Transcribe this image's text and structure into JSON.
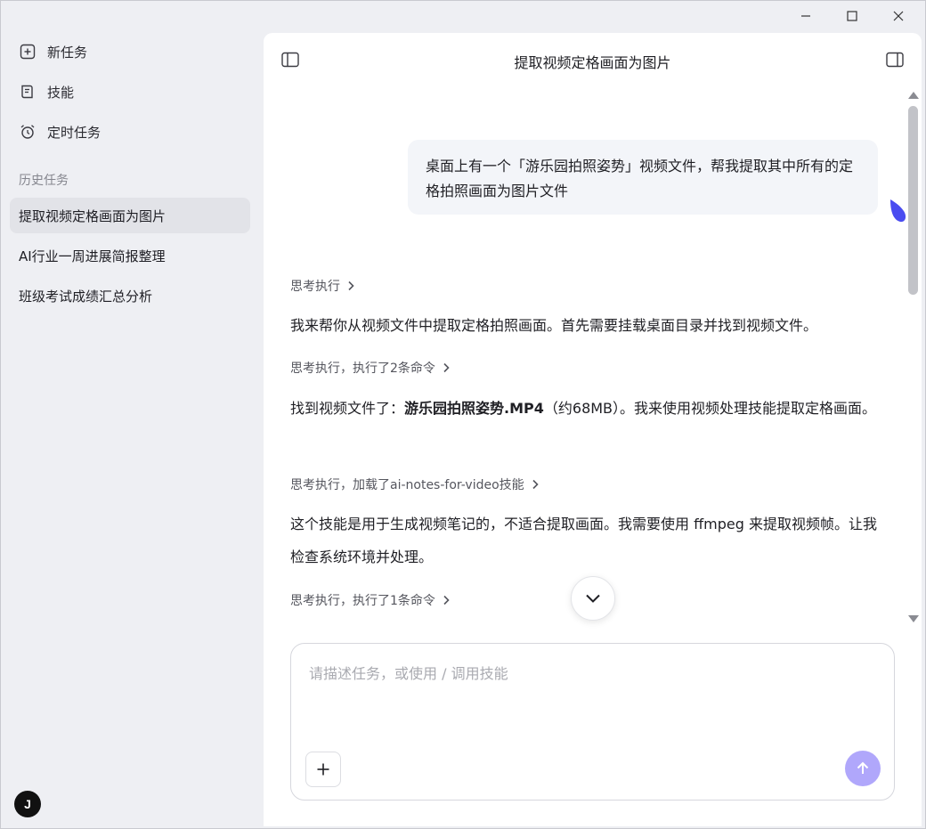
{
  "window": {
    "controls": [
      "minimize-icon",
      "maximize-icon",
      "close-icon"
    ]
  },
  "sidebar": {
    "nav": [
      {
        "label": "新任务",
        "icon": "new-task-icon"
      },
      {
        "label": "技能",
        "icon": "skills-icon"
      },
      {
        "label": "定时任务",
        "icon": "alarm-clock-icon"
      }
    ],
    "history_label": "历史任务",
    "history": [
      {
        "label": "提取视频定格画面为图片",
        "active": true
      },
      {
        "label": "AI行业一周进展简报整理",
        "active": false
      },
      {
        "label": "班级考试成绩汇总分析",
        "active": false
      }
    ],
    "avatar_initial": "J"
  },
  "main": {
    "title": "提取视频定格画面为图片",
    "user_message": "桌面上有一个「游乐园拍照姿势」视频文件，帮我提取其中所有的定格拍照画面为图片文件",
    "steps": [
      {
        "think": "思考执行",
        "text": "我来帮你从视频文件中提取定格拍照画面。首先需要挂载桌面目录并找到视频文件。"
      },
      {
        "think": "思考执行，执行了2条命令",
        "text_prefix": "找到视频文件了：",
        "text_bold": "游乐园拍照姿势.MP4",
        "text_suffix": "（约68MB）。我来使用视频处理技能提取定格画面。"
      },
      {
        "think": "思考执行，加载了ai-notes-for-video技能",
        "text": "这个技能是用于生成视频笔记的，不适合提取画面。我需要使用 ffmpeg 来提取视频帧。让我检查系统环境并处理。"
      },
      {
        "think": "思考执行，执行了1条命令"
      }
    ],
    "composer": {
      "placeholder": "请描述任务，或使用 / 调用技能"
    },
    "colors": {
      "send_button": "#b0a7fb",
      "cursor_blob": "#4a4cf0",
      "sidebar_bg": "#eeeff3",
      "active_item_bg": "#e2e3e8"
    }
  }
}
